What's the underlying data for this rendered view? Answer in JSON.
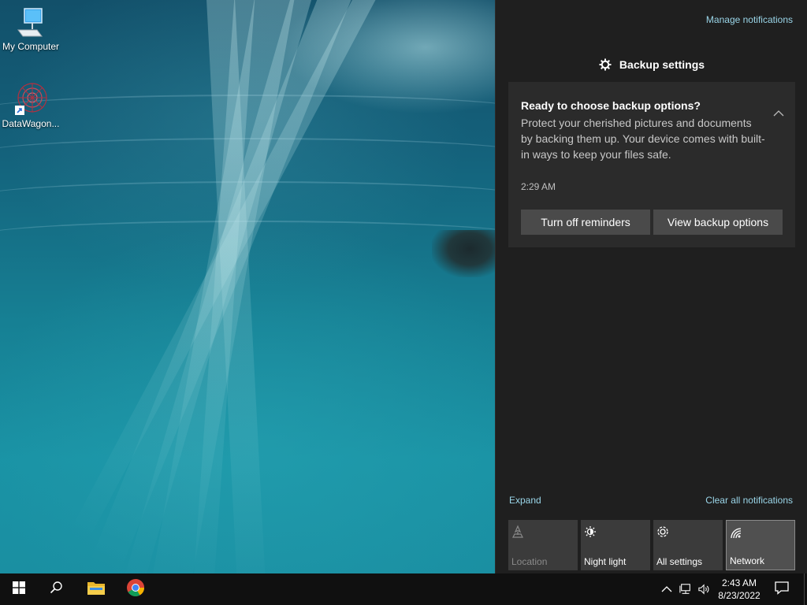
{
  "desktop": {
    "icons": [
      {
        "label": "My Computer",
        "icon": "computer-icon"
      },
      {
        "label": "DataWagon...",
        "icon": "datawagon-shortcut-icon"
      }
    ]
  },
  "action_center": {
    "manage_notifications": "Manage notifications",
    "group_title": "Backup settings",
    "toast": {
      "title": "Ready to choose backup options?",
      "body": "Protect your cherished pictures and documents by backing them up. Your device comes with built-in ways to keep your files safe.",
      "time": "2:29 AM",
      "button_turn_off": "Turn off reminders",
      "button_view": "View backup options"
    },
    "expand": "Expand",
    "clear_all": "Clear all notifications",
    "quick_actions": [
      {
        "label": "Location",
        "icon": "location-icon",
        "state": "disabled"
      },
      {
        "label": "Night light",
        "icon": "night-light-icon",
        "state": "off"
      },
      {
        "label": "All settings",
        "icon": "gear-icon",
        "state": "off"
      },
      {
        "label": "Network",
        "icon": "network-icon",
        "state": "selected"
      }
    ]
  },
  "taskbar": {
    "start": "start-icon",
    "search": "search-icon",
    "pinned": [
      "file-explorer-icon",
      "chrome-icon"
    ],
    "tray": [
      "chevron-up-icon",
      "network-icon",
      "volume-icon"
    ],
    "time": "2:43 AM",
    "date": "8/23/2022"
  },
  "colors": {
    "action_center_bg": "#1f1f1f",
    "toast_bg": "#2b2b2b",
    "link": "#9ad5e8",
    "taskbar_bg": "#101010"
  }
}
